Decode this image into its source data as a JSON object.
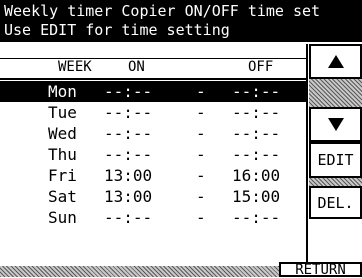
{
  "title": {
    "line1": "Weekly timer Copier ON/OFF time set",
    "line2": "Use EDIT for time setting"
  },
  "columns": {
    "week": "WEEK",
    "on": "ON",
    "off": "OFF"
  },
  "rows": [
    {
      "day": "Mon",
      "on": "--:--",
      "sep": "-",
      "off": "--:--",
      "selected": true
    },
    {
      "day": "Tue",
      "on": "--:--",
      "sep": "-",
      "off": "--:--",
      "selected": false
    },
    {
      "day": "Wed",
      "on": "--:--",
      "sep": "-",
      "off": "--:--",
      "selected": false
    },
    {
      "day": "Thu",
      "on": "--:--",
      "sep": "-",
      "off": "--:--",
      "selected": false
    },
    {
      "day": "Fri",
      "on": "13:00",
      "sep": "-",
      "off": "16:00",
      "selected": false
    },
    {
      "day": "Sat",
      "on": "13:00",
      "sep": "-",
      "off": "15:00",
      "selected": false
    },
    {
      "day": "Sun",
      "on": "--:--",
      "sep": "-",
      "off": "--:--",
      "selected": false
    }
  ],
  "buttons": {
    "up_icon": "triangle-up-icon",
    "down_icon": "triangle-down-icon",
    "edit": "EDIT",
    "delete": "DEL.",
    "return": "RETURN"
  },
  "colors": {
    "selection": "#000000",
    "background": "#ffffff"
  }
}
